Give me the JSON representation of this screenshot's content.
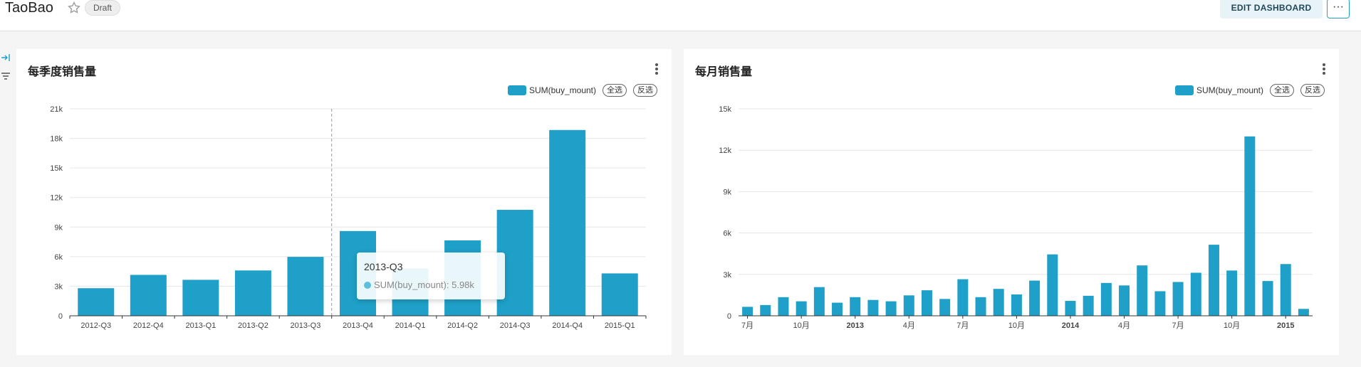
{
  "header": {
    "title": "TaoBao",
    "badge": "Draft",
    "edit_label": "EDIT DASHBOARD",
    "more_label": "···"
  },
  "colors": {
    "accent": "#1fa0c8",
    "bar": "#1fa0c8"
  },
  "icons": {
    "favorite": "star-icon",
    "sidebar_expand": "expand-sidebar-icon",
    "filter": "filter-icon",
    "more": "kebab-menu-icon"
  },
  "panels": {
    "quarterly": {
      "title": "每季度销售量",
      "legend": {
        "series": "SUM(buy_mount)",
        "select_all": "全选",
        "invert": "反选"
      },
      "tooltip": {
        "title": "2013-Q3",
        "label": "SUM(buy_mount)",
        "value": "5.98k"
      }
    },
    "monthly": {
      "title": "每月销售量",
      "legend": {
        "series": "SUM(buy_mount)",
        "select_all": "全选",
        "invert": "反选"
      }
    }
  },
  "chart_data": [
    {
      "type": "bar",
      "title": "每季度销售量",
      "categories": [
        "2012-Q3",
        "2012-Q4",
        "2013-Q1",
        "2013-Q2",
        "2013-Q3",
        "2013-Q4",
        "2014-Q1",
        "2014-Q2",
        "2014-Q3",
        "2014-Q4",
        "2015-Q1"
      ],
      "series": [
        {
          "name": "SUM(buy_mount)",
          "values": [
            2800,
            4150,
            3650,
            4600,
            5980,
            8600,
            4800,
            7650,
            10750,
            18850,
            4300
          ]
        }
      ],
      "ylim": [
        0,
        21000
      ],
      "yticks": [
        "0",
        "3k",
        "6k",
        "9k",
        "12k",
        "15k",
        "18k",
        "21k"
      ],
      "grid": true,
      "legend_position": "top-right"
    },
    {
      "type": "bar",
      "title": "每月销售量",
      "categories": [
        "2012-07",
        "2012-08",
        "2012-09",
        "2012-10",
        "2012-11",
        "2012-12",
        "2013-01",
        "2013-02",
        "2013-03",
        "2013-04",
        "2013-05",
        "2013-06",
        "2013-07",
        "2013-08",
        "2013-09",
        "2013-10",
        "2013-11",
        "2013-12",
        "2014-01",
        "2014-02",
        "2014-03",
        "2014-04",
        "2014-05",
        "2014-06",
        "2014-07",
        "2014-08",
        "2014-09",
        "2014-10",
        "2014-11",
        "2014-12",
        "2015-01",
        "2015-02"
      ],
      "series": [
        {
          "name": "SUM(buy_mount)",
          "values": [
            650,
            780,
            1350,
            1050,
            2080,
            950,
            1350,
            1150,
            1050,
            1480,
            1850,
            1220,
            2650,
            1350,
            1950,
            1550,
            2550,
            4450,
            1080,
            1450,
            2380,
            2200,
            3650,
            1780,
            2450,
            3120,
            5150,
            3280,
            13000,
            2520,
            3750,
            500
          ]
        }
      ],
      "xtick_labels": [
        {
          "index": 0,
          "label": "7月"
        },
        {
          "index": 3,
          "label": "10月"
        },
        {
          "index": 6,
          "label": "2013",
          "bold": true
        },
        {
          "index": 9,
          "label": "4月"
        },
        {
          "index": 12,
          "label": "7月"
        },
        {
          "index": 15,
          "label": "10月"
        },
        {
          "index": 18,
          "label": "2014",
          "bold": true
        },
        {
          "index": 21,
          "label": "4月"
        },
        {
          "index": 24,
          "label": "7月"
        },
        {
          "index": 27,
          "label": "10月"
        },
        {
          "index": 30,
          "label": "2015",
          "bold": true
        }
      ],
      "ylim": [
        0,
        15000
      ],
      "yticks": [
        "0",
        "3k",
        "6k",
        "9k",
        "12k",
        "15k"
      ],
      "grid": true,
      "legend_position": "top-right"
    }
  ]
}
